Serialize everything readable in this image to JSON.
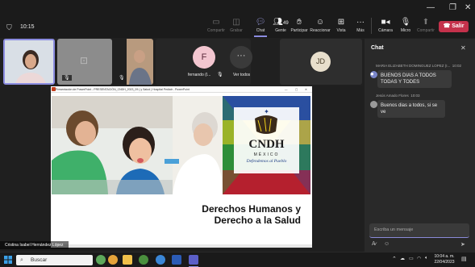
{
  "meeting": {
    "timer": "10:15",
    "toolbar": {
      "whiteboard": "Compartir",
      "record": "Grabar",
      "chat": "Chat",
      "people": "Gente",
      "people_count": "49",
      "raise_hand": "Participar",
      "react": "Reaccionar",
      "view": "Vista",
      "more": "Más",
      "camera": "Cámara",
      "mic": "Micro",
      "share": "Compartir",
      "leave": "Salir"
    }
  },
  "participants": [
    {
      "initial": "F",
      "name": "fernando (I...",
      "avatar_color": "#f3c6d0"
    },
    {
      "label": "Ver todos"
    },
    {
      "initial": "JD",
      "avatar_color": "#e8dfcc"
    }
  ],
  "shared_screen": {
    "window_title": "Presentación de PowerPoint  -  PRESENTACIÓN_CNDH_2023_09 ( y Salud ) Hospital Pediatr  -  PowerPoint",
    "slide_title_line1": "Derechos Humanos y",
    "slide_title_line2": "Derecho a la Salud",
    "logo_text": "CNDH",
    "logo_country": "MÉXICO",
    "logo_tagline": "Defendemos al Pueblo"
  },
  "presenter_name": "Cristina Isabel Hernández López",
  "chat": {
    "title": "Chat",
    "messages": [
      {
        "author": "MARIA ELIZABETH DOMINGUEZ LOPEZ (I...",
        "time": "10:02",
        "text_line1": "BUENOS DIAS A TODOS",
        "text_line2": "TODAS Y TODES"
      },
      {
        "author": "Jesús Amado Flores",
        "time": "10:03",
        "text_line1": "Buenos dias a todos, si se ve"
      }
    ],
    "input_placeholder": "Escriba un mensaje"
  },
  "taskbar": {
    "search_placeholder": "Buscar",
    "time": "10:04 a. m.",
    "date": "22/04/2023"
  },
  "colors": {
    "accent": "#6264a7",
    "leave": "#c4314b",
    "cndh_yellow": "#f2d21b",
    "cndh_blue": "#2a4fa0",
    "cndh_green": "#2f8f3a",
    "cndh_red": "#b5202e"
  }
}
